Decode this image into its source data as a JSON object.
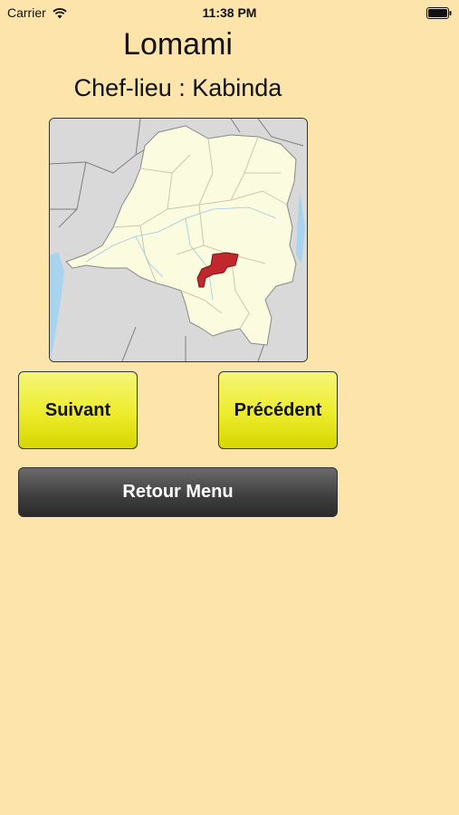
{
  "status_bar": {
    "carrier": "Carrier",
    "time": "11:38 PM",
    "icons": [
      "wifi-icon",
      "battery-icon"
    ]
  },
  "province": {
    "name": "Lomami",
    "capital_line": "Chef-lieu : Kabinda"
  },
  "map": {
    "icon": "drc-province-map",
    "highlight_color": "#c1272d",
    "country_color": "#fbfbe0",
    "neighbor_color": "#d9d9d9",
    "water_color": "#a8d4f0"
  },
  "buttons": {
    "next_label": "Suivant",
    "previous_label": "Précédent",
    "menu_label": "Retour Menu"
  },
  "colors": {
    "background": "#fde4aa",
    "button_yellow": "#ecec2c",
    "button_dark": "#3e3e3e"
  }
}
